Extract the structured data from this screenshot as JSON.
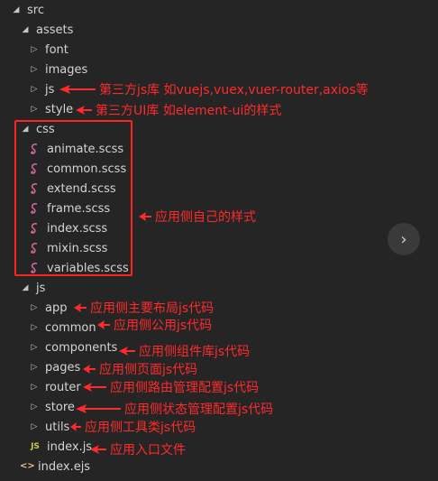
{
  "tree": {
    "src": "src",
    "assets": "assets",
    "font": "font",
    "images": "images",
    "assets_js": "js",
    "style": "style",
    "css": "css",
    "css_files": [
      "animate.scss",
      "common.scss",
      "extend.scss",
      "frame.scss",
      "index.scss",
      "mixin.scss",
      "variables.scss"
    ],
    "js": "js",
    "js_folders": [
      "app",
      "common",
      "components",
      "pages",
      "router",
      "store",
      "utils"
    ],
    "index_js": "index.js",
    "index_ejs": "index.ejs"
  },
  "annotations": {
    "assets_js": "第三方js库 如vuejs,vuex,vuer-router,axios等",
    "style": "第三方UI库 如element-ui的样式",
    "css": "应用侧自己的样式",
    "app": "应用侧主要布局js代码",
    "common": "应用侧公用js代码",
    "components": "应用侧组件库js代码",
    "pages": "应用侧页面js代码",
    "router": "应用侧路由管理配置js代码",
    "store": "应用侧状态管理配置js代码",
    "utils": "应用侧工具类js代码",
    "index_js": "应用入口文件"
  },
  "icons": {
    "expanded": "chevron-down-icon",
    "collapsed": "chevron-right-icon",
    "scss": "sass-icon",
    "js": "js-file-icon",
    "ejs": "code-file-icon",
    "next": "chevron-right-icon"
  },
  "colors": {
    "background": "#252526",
    "text": "#d4d4d4",
    "annotation": "#ff2a2a",
    "sass": "#cd6799",
    "js": "#cbcb41"
  }
}
